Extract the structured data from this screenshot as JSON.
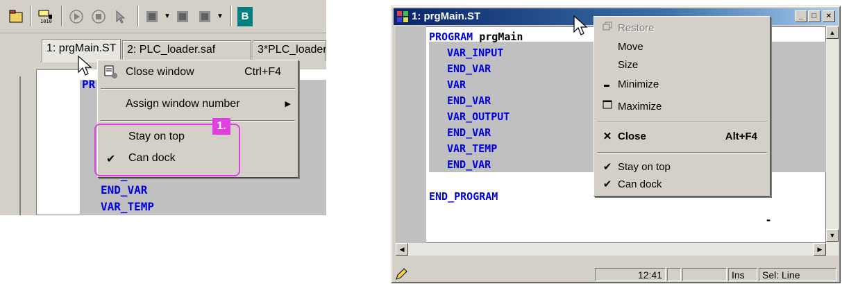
{
  "left": {
    "tabs": [
      {
        "label": "1: prgMain.ST"
      },
      {
        "label": "2: PLC_loader.saf"
      },
      {
        "label": "3*PLC_loader"
      }
    ],
    "code_lines": [
      "PR",
      "",
      "",
      "",
      "",
      "",
      "VAR_OUTPUT",
      "END_VAR",
      "VAR_TEMP"
    ],
    "menu": {
      "close_window": "Close window",
      "close_shortcut": "Ctrl+F4",
      "assign_window_number": "Assign window number",
      "stay_on_top": "Stay on top",
      "can_dock": "Can dock",
      "check_mark": "✔",
      "submenu_arrow": "▶"
    },
    "callout": "1.",
    "icons": [
      "open-file-icon",
      "compile-icon",
      "run-icon",
      "stop-icon",
      "cursor-icon",
      "breakpoint-icon",
      "debug-icon"
    ],
    "highlight_color": "#e040e0"
  },
  "right": {
    "window_title": "1: prgMain.ST",
    "caption_buttons": {
      "minimize": "_",
      "maximize": "□",
      "close": "×"
    },
    "code": [
      {
        "text": "PROGRAM prgMain",
        "keyword": "PROGRAM",
        "ident": " prgMain",
        "indent": false
      },
      {
        "text": "VAR_INPUT",
        "indent": true
      },
      {
        "text": "END_VAR",
        "indent": true
      },
      {
        "text": "VAR",
        "indent": true
      },
      {
        "text": "END_VAR",
        "indent": true
      },
      {
        "text": "VAR_OUTPUT",
        "indent": true
      },
      {
        "text": "END_VAR",
        "indent": true
      },
      {
        "text": "VAR_TEMP",
        "indent": true
      },
      {
        "text": "END_VAR",
        "indent": true
      },
      {
        "text": "",
        "indent": false
      },
      {
        "text": "END_PROGRAM",
        "indent": false
      }
    ],
    "menu": {
      "restore": "Restore",
      "move": "Move",
      "size": "Size",
      "minimize": "Minimize",
      "maximize": "Maximize",
      "close": "Close",
      "close_shortcut": "Alt+F4",
      "stay_on_top": "Stay on top",
      "can_dock": "Can dock",
      "check_mark": "✔",
      "close_glyph": "✕"
    },
    "status": {
      "position": "12:41",
      "mode": "Ins",
      "selection": "Sel: Line"
    },
    "cursor_mark": "-"
  },
  "colors": {
    "keyword": "#0000e0",
    "title_start": "#0a246a",
    "title_end": "#a6caf0",
    "face": "#d4d0c8"
  }
}
